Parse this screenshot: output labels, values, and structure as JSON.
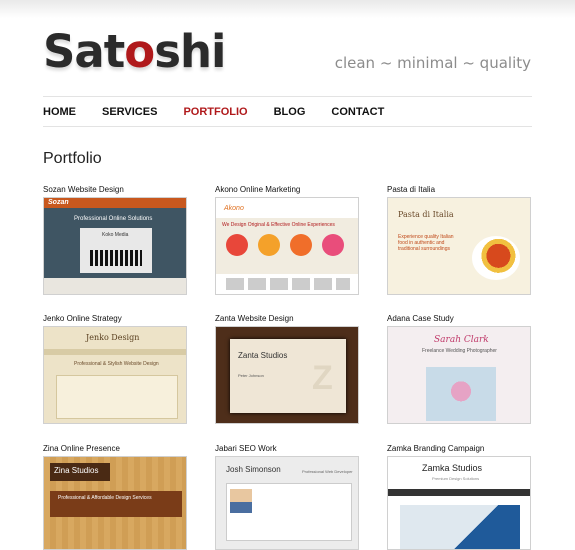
{
  "site": {
    "logo_prefix": "Sat",
    "logo_o": "o",
    "logo_suffix": "shi",
    "tagline": "clean ~ minimal ~ quality"
  },
  "nav": {
    "items": [
      "HOME",
      "SERVICES",
      "PORTFOLIO",
      "BLOG",
      "CONTACT"
    ],
    "active": "PORTFOLIO"
  },
  "page_title": "Portfolio",
  "colors": {
    "accent": "#b0191b",
    "text": "#111111"
  },
  "portfolio": [
    {
      "caption": "Sozan Website Design",
      "thumb": {
        "brand": "Sozan",
        "headline": "Professional Online Solutions",
        "sub": "Koko Media"
      }
    },
    {
      "caption": "Akono Online Marketing",
      "thumb": {
        "brand": "Akono",
        "headline": "We Design Original & Effective Online Experiences"
      }
    },
    {
      "caption": "Pasta di Italia",
      "thumb": {
        "brand": "Pasta di Italia",
        "headline": "Experience quality Italian food in authentic and traditional surroundings"
      }
    },
    {
      "caption": "Jenko Online Strategy",
      "thumb": {
        "brand": "Jenko Design",
        "headline": "Professional & Stylish Website Design"
      }
    },
    {
      "caption": "Zanta Website Design",
      "thumb": {
        "brand": "Zanta Studios",
        "headline": "Peter Johnson"
      }
    },
    {
      "caption": "Adana Case Study",
      "thumb": {
        "brand": "Sarah Clark",
        "headline": "Freelance Wedding Photographer"
      }
    },
    {
      "caption": "Zina Online Presence",
      "thumb": {
        "brand": "Zina Studios",
        "headline": "Professional & Affordable Design Services"
      }
    },
    {
      "caption": "Jabari SEO Work",
      "thumb": {
        "brand": "Josh Simonson",
        "headline": "Professional Web Developer"
      }
    },
    {
      "caption": "Zamka Branding Campaign",
      "thumb": {
        "brand": "Zamka Studios",
        "headline": "Premium Design Solutions"
      }
    }
  ]
}
